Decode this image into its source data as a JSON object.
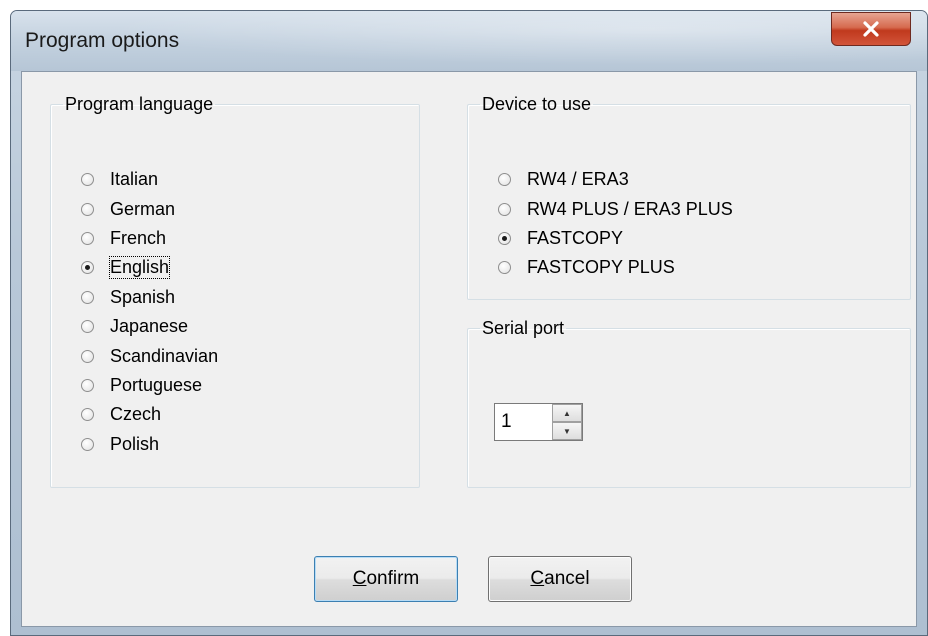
{
  "window": {
    "title": "Program options"
  },
  "language_group": {
    "legend": "Program language",
    "options": [
      {
        "label": "Italian",
        "checked": false
      },
      {
        "label": "German",
        "checked": false
      },
      {
        "label": "French",
        "checked": false
      },
      {
        "label": "English",
        "checked": true
      },
      {
        "label": "Spanish",
        "checked": false
      },
      {
        "label": "Japanese",
        "checked": false
      },
      {
        "label": "Scandinavian",
        "checked": false
      },
      {
        "label": "Portuguese",
        "checked": false
      },
      {
        "label": "Czech",
        "checked": false
      },
      {
        "label": "Polish",
        "checked": false
      }
    ]
  },
  "device_group": {
    "legend": "Device to use",
    "options": [
      {
        "label": "RW4 / ERA3",
        "checked": false
      },
      {
        "label": "RW4 PLUS / ERA3 PLUS",
        "checked": false
      },
      {
        "label": "FASTCOPY",
        "checked": true
      },
      {
        "label": "FASTCOPY PLUS",
        "checked": false
      }
    ]
  },
  "serial_group": {
    "legend": "Serial port",
    "value": "1"
  },
  "buttons": {
    "confirm_mnemonic": "C",
    "confirm_rest": "onfirm",
    "cancel_mnemonic": "C",
    "cancel_rest": "ancel"
  },
  "icons": {
    "close": "close-icon",
    "spin_up": "chevron-up-icon",
    "spin_down": "chevron-down-icon"
  },
  "colors": {
    "close_button": "#c0391d",
    "dialog_face": "#f0f0f0",
    "groupbox_border": "#d5dfe5"
  }
}
